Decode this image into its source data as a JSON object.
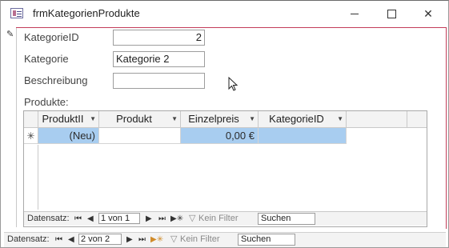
{
  "window": {
    "title": "frmKategorienProdukte"
  },
  "form": {
    "fields": [
      {
        "label": "KategorieID",
        "value": "2"
      },
      {
        "label": "Kategorie",
        "value": "Kategorie 2"
      },
      {
        "label": "Beschreibung",
        "value": ""
      }
    ],
    "subform_label": "Produkte:"
  },
  "subform": {
    "columns": [
      "ProduktII",
      "Produkt",
      "Einzelpreis",
      "KategorieID"
    ],
    "new_row_marker": "✳",
    "new_row": {
      "ProduktII": "(Neu)",
      "Produkt": "",
      "Einzelpreis": "0,00 €",
      "KategorieID": ""
    },
    "nav": {
      "label": "Datensatz:",
      "position": "1 von 1",
      "filter": "Kein Filter",
      "search": "Suchen"
    }
  },
  "main_nav": {
    "label": "Datensatz:",
    "position": "2 von 2",
    "filter": "Kein Filter",
    "search": "Suchen"
  },
  "colors": {
    "accent_border": "#c33d5a",
    "highlight": "#a8cdf0"
  }
}
